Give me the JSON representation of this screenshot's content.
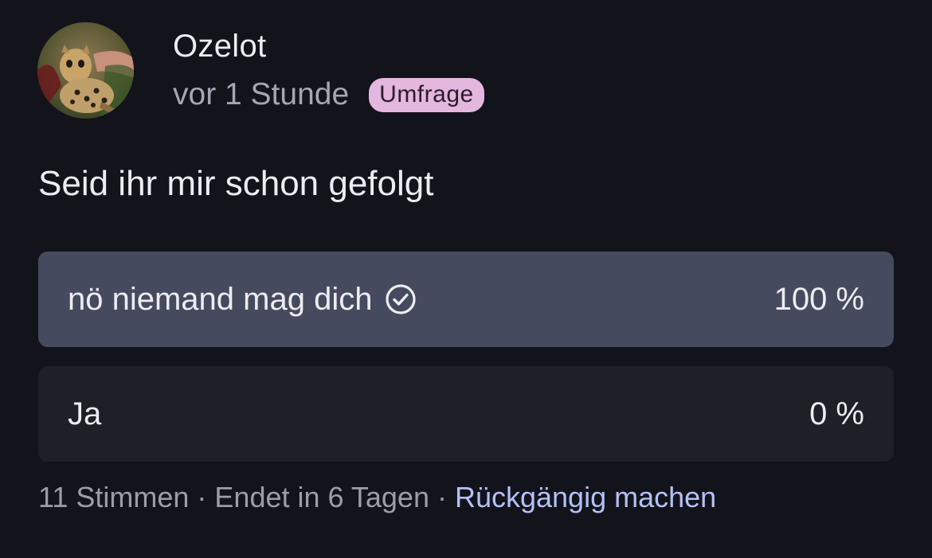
{
  "post": {
    "author": "Ozelot",
    "time": "vor 1 Stunde",
    "badge": "Umfrage",
    "question": "Seid ihr mir schon gefolgt"
  },
  "poll": {
    "options": [
      {
        "label": "nö niemand mag dich",
        "percent": "100 %",
        "fraction": 1.0,
        "voted": true
      },
      {
        "label": "Ja",
        "percent": "0 %",
        "fraction": 0.0,
        "voted": false
      }
    ],
    "votes": "11 Stimmen",
    "separator": " · ",
    "ends": "Endet in 6 Tagen",
    "undo": "Rückgängig machen"
  },
  "colors": {
    "background": "#13131b",
    "badge": "#e3b7de",
    "option_fill": "#454a5e",
    "option_track": "#1f1f27",
    "link": "#b3c1f4"
  },
  "icons": {
    "avatar": "ocelot-kitten-photo",
    "voted": "check-circle-icon"
  }
}
